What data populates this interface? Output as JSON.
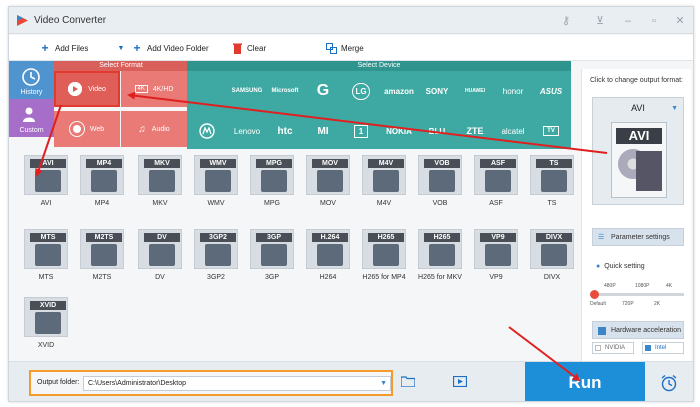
{
  "window": {
    "title": "Video Converter"
  },
  "toolbar": {
    "add_files": "Add Files",
    "add_video_folder": "Add Video Folder",
    "clear": "Clear",
    "merge": "Merge"
  },
  "categories": {
    "select_format": "Select Format",
    "select_device": "Select Device"
  },
  "side": {
    "history": "History",
    "custom": "Custom"
  },
  "format_categories": [
    {
      "label": "Video"
    },
    {
      "label": "4K/HD"
    },
    {
      "label": "Web"
    },
    {
      "label": "Audio"
    }
  ],
  "devices": [
    "",
    "SAMSUNG",
    "Microsoft",
    "G",
    "LG",
    "amazon",
    "SONY",
    "HUAWEI",
    "honor",
    "ASUS",
    "",
    "Lenovo",
    "htc",
    "MI",
    "1",
    "NOKIA",
    "BLU",
    "ZTE",
    "alcatel",
    "TV"
  ],
  "formats": [
    {
      "badge": "AVI",
      "caption": "AVI"
    },
    {
      "badge": "MP4",
      "caption": "MP4"
    },
    {
      "badge": "MKV",
      "caption": "MKV"
    },
    {
      "badge": "WMV",
      "caption": "WMV"
    },
    {
      "badge": "MPG",
      "caption": "MPG"
    },
    {
      "badge": "MOV",
      "caption": "MOV"
    },
    {
      "badge": "M4V",
      "caption": "M4V"
    },
    {
      "badge": "VOB",
      "caption": "VOB"
    },
    {
      "badge": "ASF",
      "caption": "ASF"
    },
    {
      "badge": "TS",
      "caption": "TS"
    },
    {
      "badge": "MTS",
      "caption": "MTS"
    },
    {
      "badge": "M2TS",
      "caption": "M2TS"
    },
    {
      "badge": "DV",
      "caption": "DV"
    },
    {
      "badge": "3GP2",
      "caption": "3GP2"
    },
    {
      "badge": "3GP",
      "caption": "3GP"
    },
    {
      "badge": "H.264",
      "caption": "H264"
    },
    {
      "badge": "H265",
      "caption": "H265 for MP4"
    },
    {
      "badge": "H265",
      "caption": "H265 for MKV"
    },
    {
      "badge": "VP9",
      "caption": "VP9"
    },
    {
      "badge": "DIVX",
      "caption": "DIVX"
    },
    {
      "badge": "XVID",
      "caption": "XVID"
    }
  ],
  "right_panel": {
    "hint": "Click to change output format:",
    "selected_format": "AVI",
    "format_badge": "AVI",
    "parameter_settings": "Parameter settings",
    "quick_setting": "Quick setting",
    "ticks_top": [
      "480P",
      "1080P",
      "4K"
    ],
    "ticks_bottom": [
      "Default",
      "720P",
      "2K"
    ],
    "quality_level": 0,
    "hardware_acceleration": "Hardware acceleration",
    "nvidia": "NVIDIA",
    "intel": "Intel"
  },
  "bottom": {
    "output_folder_label": "Output folder:",
    "output_folder_value": "C:\\Users\\Administrator\\Desktop",
    "run": "Run"
  },
  "colors": {
    "format_red": "#e97a75",
    "device_teal": "#3ea9a2",
    "run_blue": "#1d8fd9",
    "highlight_orange": "#f59b2b",
    "arrow_red": "#e02020"
  }
}
